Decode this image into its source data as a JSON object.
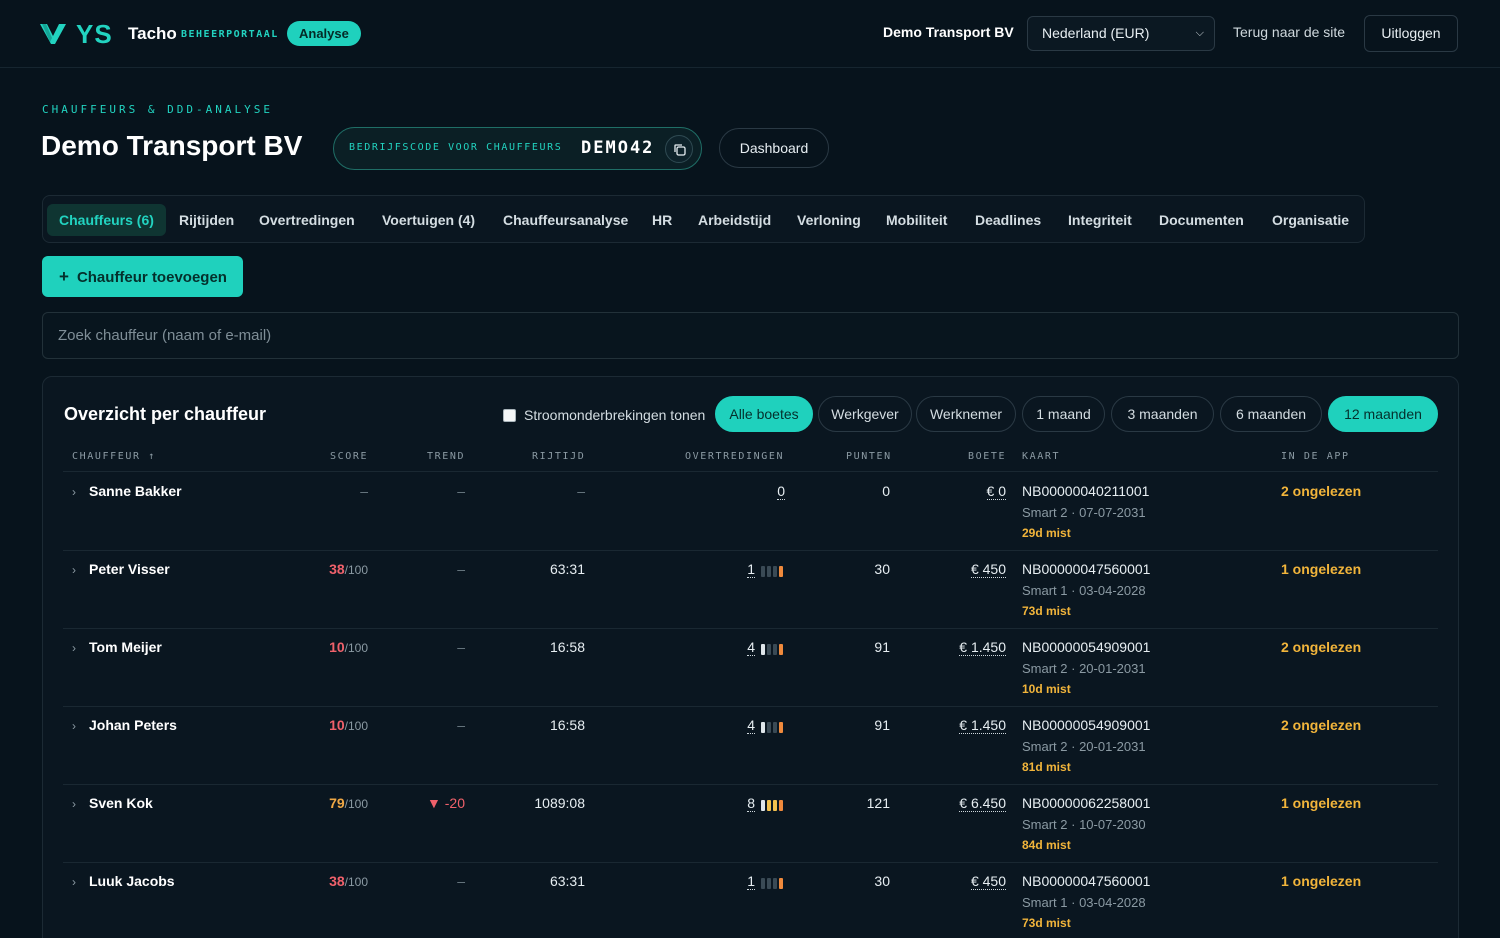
{
  "header": {
    "logo_text": "YS",
    "brand": "Tacho",
    "brand_sub": "BEHEERPORTAAL",
    "badge": "Analyse",
    "company": "Demo Transport BV",
    "country_select": "Nederland (EUR)",
    "back_link": "Terug naar de site",
    "logout": "Uitloggen"
  },
  "page": {
    "eyebrow": "CHAUFFEURS & DDD-ANALYSE",
    "title": "Demo Transport BV",
    "code_label": "BEDRIJFSCODE VOOR CHAUFFEURS",
    "code_value": "DEMO42",
    "dashboard_button": "Dashboard"
  },
  "tabs": [
    {
      "label": "Chauffeurs (6)",
      "active": true
    },
    {
      "label": "Rijtijden"
    },
    {
      "label": "Overtredingen"
    },
    {
      "label": "Voertuigen (4)"
    },
    {
      "label": "Chauffeursanalyse"
    },
    {
      "label": "HR"
    },
    {
      "label": "Arbeidstijd"
    },
    {
      "label": "Verloning"
    },
    {
      "label": "Mobiliteit"
    },
    {
      "label": "Deadlines"
    },
    {
      "label": "Integriteit"
    },
    {
      "label": "Documenten"
    },
    {
      "label": "Organisatie"
    }
  ],
  "actions": {
    "add_driver": "Chauffeur toevoegen",
    "search_placeholder": "Zoek chauffeur (naam of e-mail)"
  },
  "overview": {
    "title": "Overzicht per chauffeur",
    "outage_toggle": "Stroomonderbrekingen tonen",
    "filters": [
      "Alle boetes",
      "Werkgever",
      "Werknemer"
    ],
    "periods": [
      "1 maand",
      "3 maanden",
      "6 maanden",
      "12 maanden"
    ],
    "active_filter": "Alle boetes",
    "active_period": "12 maanden",
    "columns": [
      "CHAUFFEUR ↑",
      "SCORE",
      "TREND",
      "RIJTIJD",
      "OVERTREDINGEN",
      "PUNTEN",
      "BOETE",
      "KAART",
      "IN DE APP"
    ],
    "rows": [
      {
        "name": "Sanne Bakker",
        "score": "–",
        "score_den": "",
        "trend": "–",
        "drive": "–",
        "violations": "0",
        "bars": [],
        "points": "0",
        "fine": "€ 0",
        "card": "NB00000040211001",
        "card_sub": "Smart 2 · 07-07-2031",
        "card_miss": "29d mist",
        "app": "2 ongelezen"
      },
      {
        "name": "Peter Visser",
        "score": "38",
        "score_den": "/100",
        "trend": "–",
        "drive": "63:31",
        "violations": "1",
        "bars": [
          "d",
          "d",
          "d",
          "o"
        ],
        "points": "30",
        "fine": "€ 450",
        "card": "NB00000047560001",
        "card_sub": "Smart 1 · 03-04-2028",
        "card_miss": "73d mist",
        "app": "1 ongelezen"
      },
      {
        "name": "Tom Meijer",
        "score": "10",
        "score_den": "/100",
        "trend": "–",
        "drive": "16:58",
        "violations": "4",
        "bars": [
          "w",
          "d",
          "d",
          "o"
        ],
        "points": "91",
        "fine": "€ 1.450",
        "card": "NB00000054909001",
        "card_sub": "Smart 2 · 20-01-2031",
        "card_miss": "10d mist",
        "app": "2 ongelezen"
      },
      {
        "name": "Johan Peters",
        "score": "10",
        "score_den": "/100",
        "trend": "–",
        "drive": "16:58",
        "violations": "4",
        "bars": [
          "w",
          "d",
          "d",
          "o"
        ],
        "points": "91",
        "fine": "€ 1.450",
        "card": "NB00000054909001",
        "card_sub": "Smart 2 · 20-01-2031",
        "card_miss": "81d mist",
        "app": "2 ongelezen"
      },
      {
        "name": "Sven Kok",
        "score": "79",
        "score_den": "/100",
        "trend": "▼ -20",
        "drive": "1089:08",
        "violations": "8",
        "bars": [
          "w",
          "y",
          "y",
          "o"
        ],
        "points": "121",
        "fine": "€ 6.450",
        "card": "NB00000062258001",
        "card_sub": "Smart 2 · 10-07-2030",
        "card_miss": "84d mist",
        "app": "1 ongelezen"
      },
      {
        "name": "Luuk Jacobs",
        "score": "38",
        "score_den": "/100",
        "trend": "–",
        "drive": "63:31",
        "violations": "1",
        "bars": [
          "d",
          "d",
          "d",
          "o"
        ],
        "points": "30",
        "fine": "€ 450",
        "card": "NB00000047560001",
        "card_sub": "Smart 1 · 03-04-2028",
        "card_miss": "73d mist",
        "app": "1 ongelezen"
      }
    ]
  },
  "colors": {
    "accent": "#1fd1bd",
    "background": "#07131c",
    "warning": "#f2b53b",
    "danger": "#f0616b"
  }
}
